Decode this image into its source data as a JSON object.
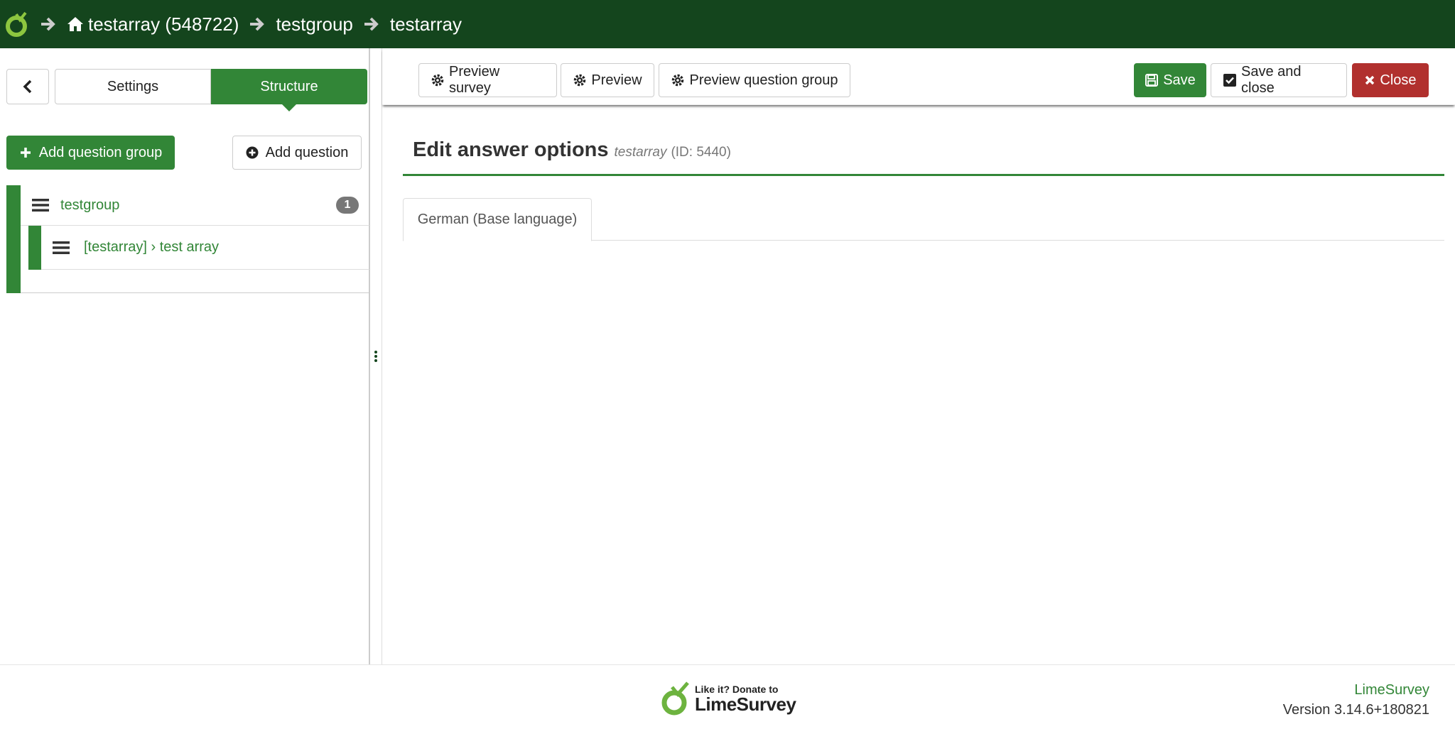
{
  "breadcrumb": {
    "items": [
      {
        "label": "testarray (548722)",
        "icon": "home-icon"
      },
      {
        "label": "testgroup"
      },
      {
        "label": "testarray"
      }
    ]
  },
  "sidebar": {
    "back_icon": "chevron-left-icon",
    "tabs": [
      {
        "label": "Settings",
        "active": false
      },
      {
        "label": "Structure",
        "active": true
      }
    ],
    "add_group_label": "Add question group",
    "add_question_label": "Add question",
    "groups": [
      {
        "title": "testgroup",
        "count": "1",
        "expanded": true,
        "questions": [
          {
            "title": "[testarray] › test array"
          }
        ]
      }
    ]
  },
  "toolbar": {
    "preview_survey_label": "Preview survey",
    "preview_label": "Preview",
    "preview_group_label": "Preview question group",
    "save_label": "Save",
    "save_close_label": "Save and close",
    "close_label": "Close"
  },
  "main": {
    "title": "Edit answer options",
    "subtitle": "testarray",
    "id_text": "(ID: 5440)",
    "language_tabs": [
      {
        "label": "German (Base language)",
        "active": true
      }
    ]
  },
  "footer": {
    "donate_top": "Like it? Donate to",
    "donate_bottom": "LimeSurvey",
    "brand": "LimeSurvey",
    "version": "Version 3.14.6+180821"
  },
  "colors": {
    "topbar": "#14451d",
    "accent": "#328637",
    "danger": "#b1302e"
  }
}
